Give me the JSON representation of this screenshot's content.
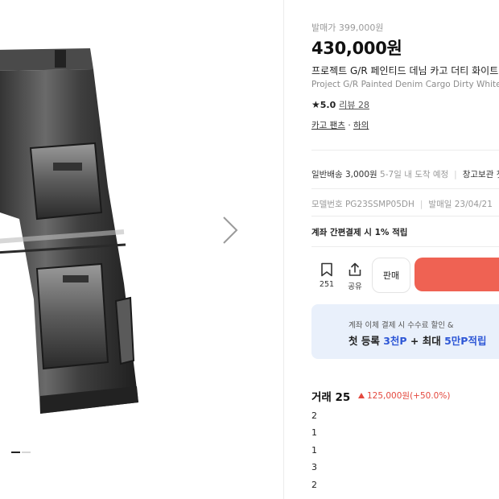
{
  "product": {
    "release_label": "발매가 399,000원",
    "price": "430,000원",
    "name_ko": "프로젝트 G/R 페인티드 데님 카고 더티 화이트",
    "name_en": "Project G/R Painted Denim Cargo Dirty White",
    "rating_score": "5.0",
    "review_link": "리뷰 28",
    "category_primary": "카고 팬츠",
    "category_secondary": "하의",
    "category_sep": "·"
  },
  "shipping": {
    "text": "일반배송 3,000원",
    "sub": "5-7일 내 도착 예정",
    "sep": "|",
    "warehouse": "창고보관 첫"
  },
  "info": {
    "model_label": "모델번호 PG23SSMP05DH",
    "sep": "|",
    "release_date": "발매일 23/04/21"
  },
  "payment_note": "계좌 간편결제 시 1% 적립",
  "actions": {
    "bookmark_count": "251",
    "share_label": "공유",
    "sell_label": "판매"
  },
  "promo": {
    "sub": "계좌 이체 결제 시 수수료 할인 &",
    "main_a": "첫 등록 ",
    "main_b": "3천P",
    "main_c": " + 최대 ",
    "main_d": "5만P적립"
  },
  "trades": {
    "title": "거래 25",
    "change": "125,000원(+50.0%)",
    "quantities": [
      "2",
      "1",
      "1",
      "3",
      "2"
    ]
  },
  "colors": {
    "accent_red": "#ef6253",
    "price_up": "#e4483e",
    "promo_blue": "#2e57d6",
    "promo_bg": "#e9f0fb"
  },
  "gallery": {
    "dots": 2,
    "active_dot": 1
  }
}
